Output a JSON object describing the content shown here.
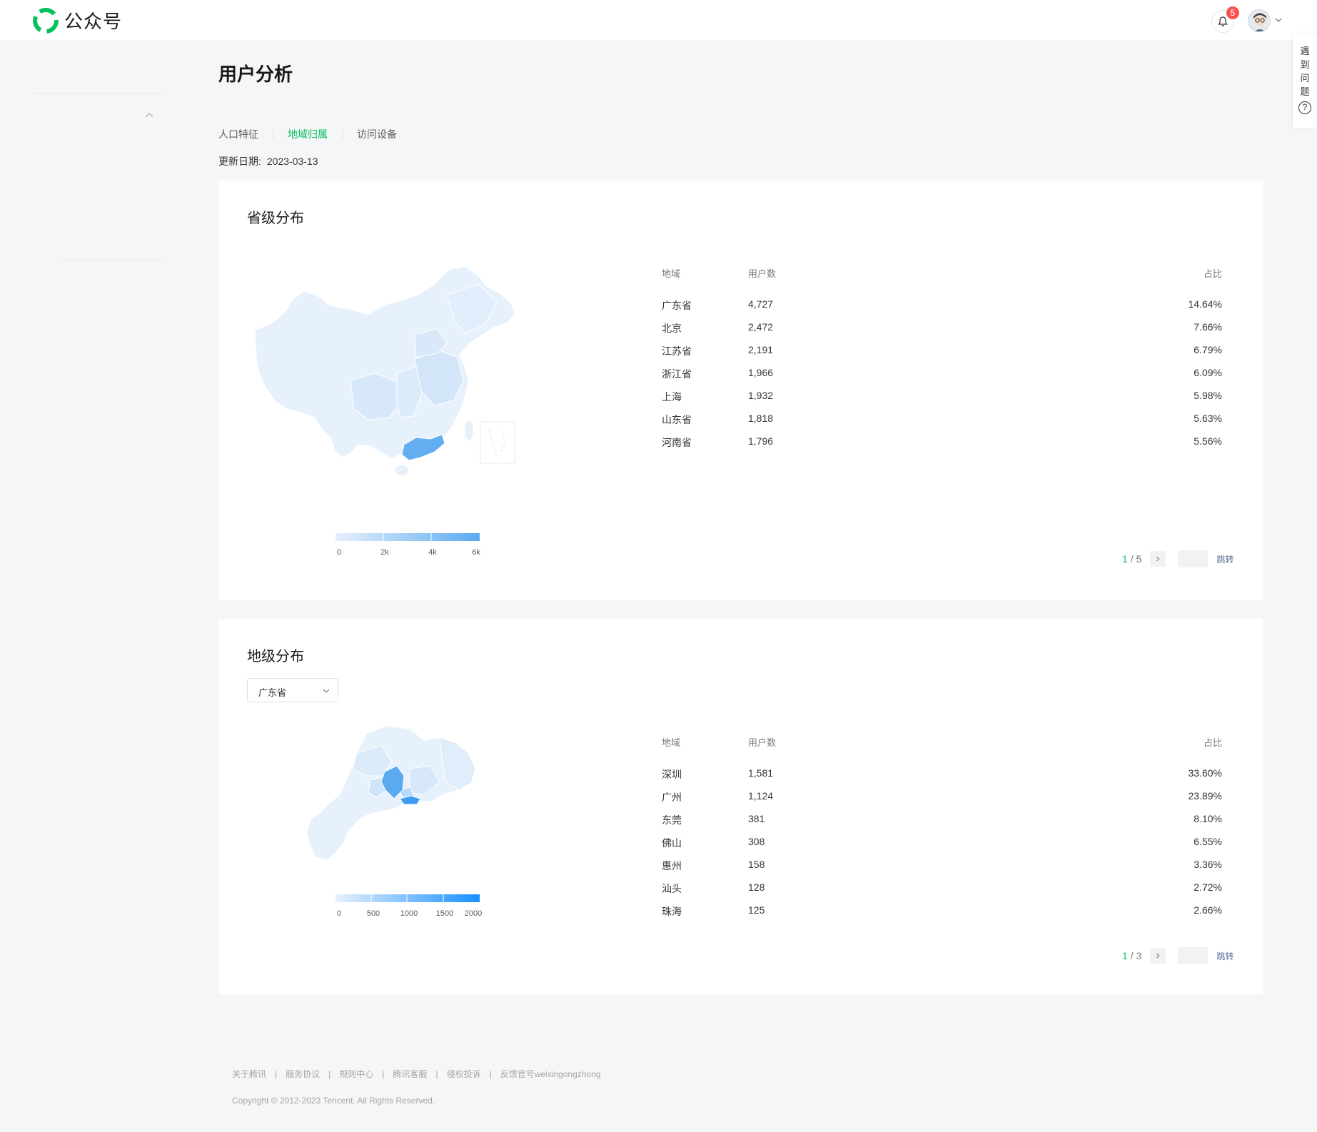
{
  "brand": {
    "name": "公众号"
  },
  "header": {
    "notification_count": "5"
  },
  "help_tab": {
    "chars": [
      "遇",
      "到",
      "问",
      "题"
    ],
    "icon": "question-circle-icon"
  },
  "page": {
    "title": "用户分析"
  },
  "tabs": [
    {
      "label": "人口特征",
      "active": false
    },
    {
      "label": "地域归属",
      "active": true
    },
    {
      "label": "访问设备",
      "active": false
    }
  ],
  "update": {
    "label": "更新日期:",
    "value": "2023-03-13"
  },
  "province_card": {
    "title": "省级分布",
    "legend_labels": [
      "0",
      "2k",
      "4k",
      "6k"
    ],
    "table": {
      "headers": [
        "地域",
        "用户数",
        "占比"
      ],
      "rows": [
        [
          "广东省",
          "4,727",
          "14.64%"
        ],
        [
          "北京",
          "2,472",
          "7.66%"
        ],
        [
          "江苏省",
          "2,191",
          "6.79%"
        ],
        [
          "浙江省",
          "1,966",
          "6.09%"
        ],
        [
          "上海",
          "1,932",
          "5.98%"
        ],
        [
          "山东省",
          "1,818",
          "5.63%"
        ],
        [
          "河南省",
          "1,796",
          "5.56%"
        ]
      ]
    },
    "pager": {
      "current": "1",
      "total": "/ 5",
      "jump_label": "跳转"
    }
  },
  "city_card": {
    "title": "地级分布",
    "select_value": "广东省",
    "legend_labels": [
      "0",
      "500",
      "1000",
      "1500",
      "2000"
    ],
    "table": {
      "headers": [
        "地域",
        "用户数",
        "占比"
      ],
      "rows": [
        [
          "深圳",
          "1,581",
          "33.60%"
        ],
        [
          "广州",
          "1,124",
          "23.89%"
        ],
        [
          "东莞",
          "381",
          "8.10%"
        ],
        [
          "佛山",
          "308",
          "6.55%"
        ],
        [
          "惠州",
          "158",
          "3.36%"
        ],
        [
          "汕头",
          "128",
          "2.72%"
        ],
        [
          "珠海",
          "125",
          "2.66%"
        ]
      ]
    },
    "pager": {
      "current": "1",
      "total": "/ 3",
      "jump_label": "跳转"
    }
  },
  "footer": {
    "links": [
      "关于腾讯",
      "服务协议",
      "规则中心",
      "腾讯客服",
      "侵权投诉",
      "反馈官号weixingongzhong"
    ],
    "copyright": "Copyright © 2012-2023 Tencent. All Rights Reserved."
  },
  "colors": {
    "accent": "#07c160",
    "map_low": "#e6f1fc",
    "map_high": "#5aaaf0",
    "badge": "#fa5151"
  }
}
